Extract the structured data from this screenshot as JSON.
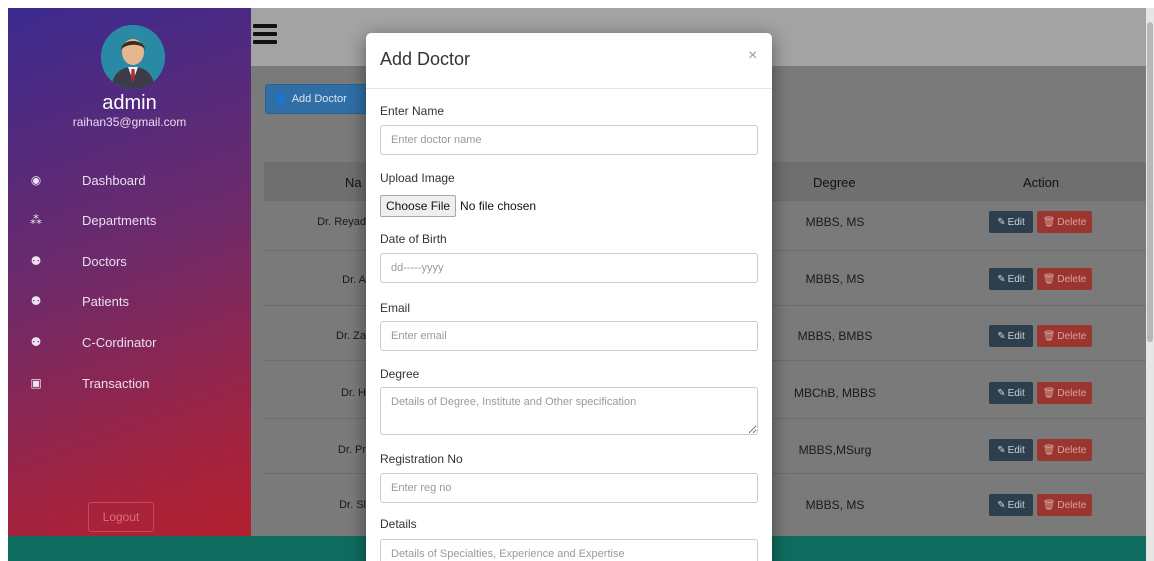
{
  "sidebar": {
    "user_name": "admin",
    "user_email": "raihan35@gmail.com",
    "items": [
      {
        "label": "Dashboard",
        "icon": "dashboard-icon"
      },
      {
        "label": "Departments",
        "icon": "sitemap-icon"
      },
      {
        "label": "Doctors",
        "icon": "users-icon"
      },
      {
        "label": "Patients",
        "icon": "users-icon"
      },
      {
        "label": "C-Cordinator",
        "icon": "users-icon"
      },
      {
        "label": "Transaction",
        "icon": "money-icon"
      }
    ],
    "logout_label": "Logout"
  },
  "toolbar": {
    "add_doctor_label": "Add Doctor"
  },
  "table": {
    "headers": {
      "name": "Na",
      "degree": "Degree",
      "action": "Action"
    },
    "rows": [
      {
        "name": "Dr. Reyad",
        "degree": "MBBS, MS"
      },
      {
        "name": "Dr. A",
        "degree": "MBBS, MS"
      },
      {
        "name": "Dr. Za",
        "degree": "MBBS, BMBS"
      },
      {
        "name": "Dr. H",
        "degree": "MBChB, MBBS"
      },
      {
        "name": "Dr. Pr",
        "degree": "MBBS,MSurg"
      },
      {
        "name": "Dr. Sl",
        "degree": "MBBS, MS"
      }
    ],
    "edit_label": "Edit",
    "delete_label": "Delete"
  },
  "modal": {
    "title": "Add Doctor",
    "close_glyph": "×",
    "fields": {
      "name_label": "Enter Name",
      "name_placeholder": "Enter doctor name",
      "image_label": "Upload Image",
      "file_button": "Choose File",
      "file_status": "No file chosen",
      "dob_label": "Date of Birth",
      "dob_placeholder": "dd-----yyyy",
      "email_label": "Email",
      "email_placeholder": "Enter email",
      "degree_label": "Degree",
      "degree_placeholder": "Details of Degree, Institute and Other specification",
      "reg_label": "Registration No",
      "reg_placeholder": "Enter reg no",
      "details_label": "Details",
      "details_placeholder": "Details of Specialties, Experience and Expertise"
    }
  },
  "colors": {
    "sidebar_top": "#3b2a8f",
    "sidebar_bottom": "#b81f2b",
    "footer": "#0f6d5f",
    "primary": "#2f6fa6",
    "danger": "#9a3530"
  }
}
